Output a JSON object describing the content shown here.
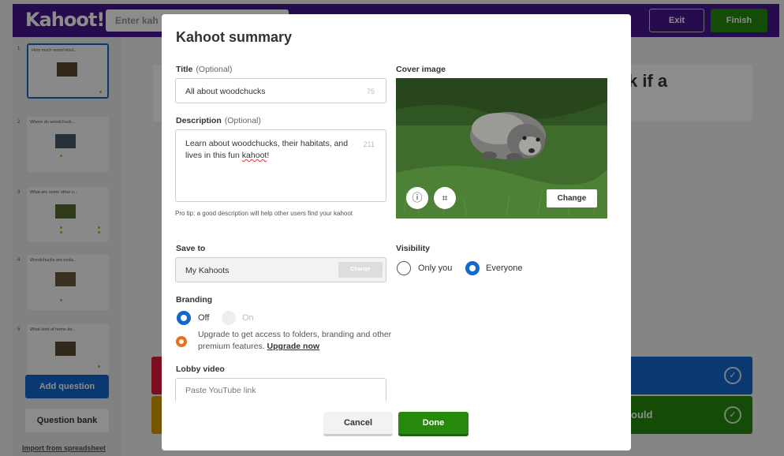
{
  "header": {
    "logo": "Kahoot!",
    "title_placeholder": "Enter kah",
    "exit_label": "Exit",
    "finish_label": "Finish"
  },
  "sidebar": {
    "slides": [
      {
        "number": "1",
        "title": "How much wood woul..."
      },
      {
        "number": "2",
        "title": "Where do woodchuck..."
      },
      {
        "number": "3",
        "title": "What are some other n..."
      },
      {
        "number": "4",
        "title": "Woodchucks are enda..."
      },
      {
        "number": "5",
        "title": "What kind of home do ..."
      }
    ],
    "add_question": "Add question",
    "question_bank": "Question bank",
    "import": "Import from spreadsheet"
  },
  "editor": {
    "question_fragment": "k if a",
    "answer_green_fragment": "ould"
  },
  "modal": {
    "title": "Kahoot summary",
    "title_label": "Title",
    "title_optional": "(Optional)",
    "title_value": "All about woodchucks",
    "title_counter": "75",
    "description_label": "Description",
    "description_optional": "(Optional)",
    "description_value_part1": "Learn about woodchucks, their habitats, and lives in this fun ",
    "description_value_misspelled": "kahoot",
    "description_value_part2": "!",
    "description_counter": "211",
    "tip": "Pro tip: a good description will help other users find your kahoot",
    "save_to_label": "Save to",
    "save_to_value": "My Kahoots",
    "save_to_change": "Change",
    "branding_label": "Branding",
    "branding_off": "Off",
    "branding_on": "On",
    "upgrade_text": "Upgrade to get access to folders, branding and other premium features.",
    "upgrade_link": "Upgrade now",
    "lobby_label": "Lobby video",
    "lobby_placeholder": "Paste YouTube link",
    "cover_label": "Cover image",
    "cover_change": "Change",
    "visibility_label": "Visibility",
    "visibility_only_you": "Only you",
    "visibility_everyone": "Everyone",
    "cancel": "Cancel",
    "done": "Done"
  },
  "colors": {
    "brand_purple": "#46178f",
    "primary_blue": "#1368ce",
    "success_green": "#26890c",
    "answer_red": "#e21b3c",
    "answer_yellow": "#d89e00",
    "upgrade_orange": "#e8711a"
  },
  "icons": {
    "info": "info-icon",
    "crop": "crop-icon",
    "check": "check-icon",
    "upgrade": "upgrade-icon"
  }
}
